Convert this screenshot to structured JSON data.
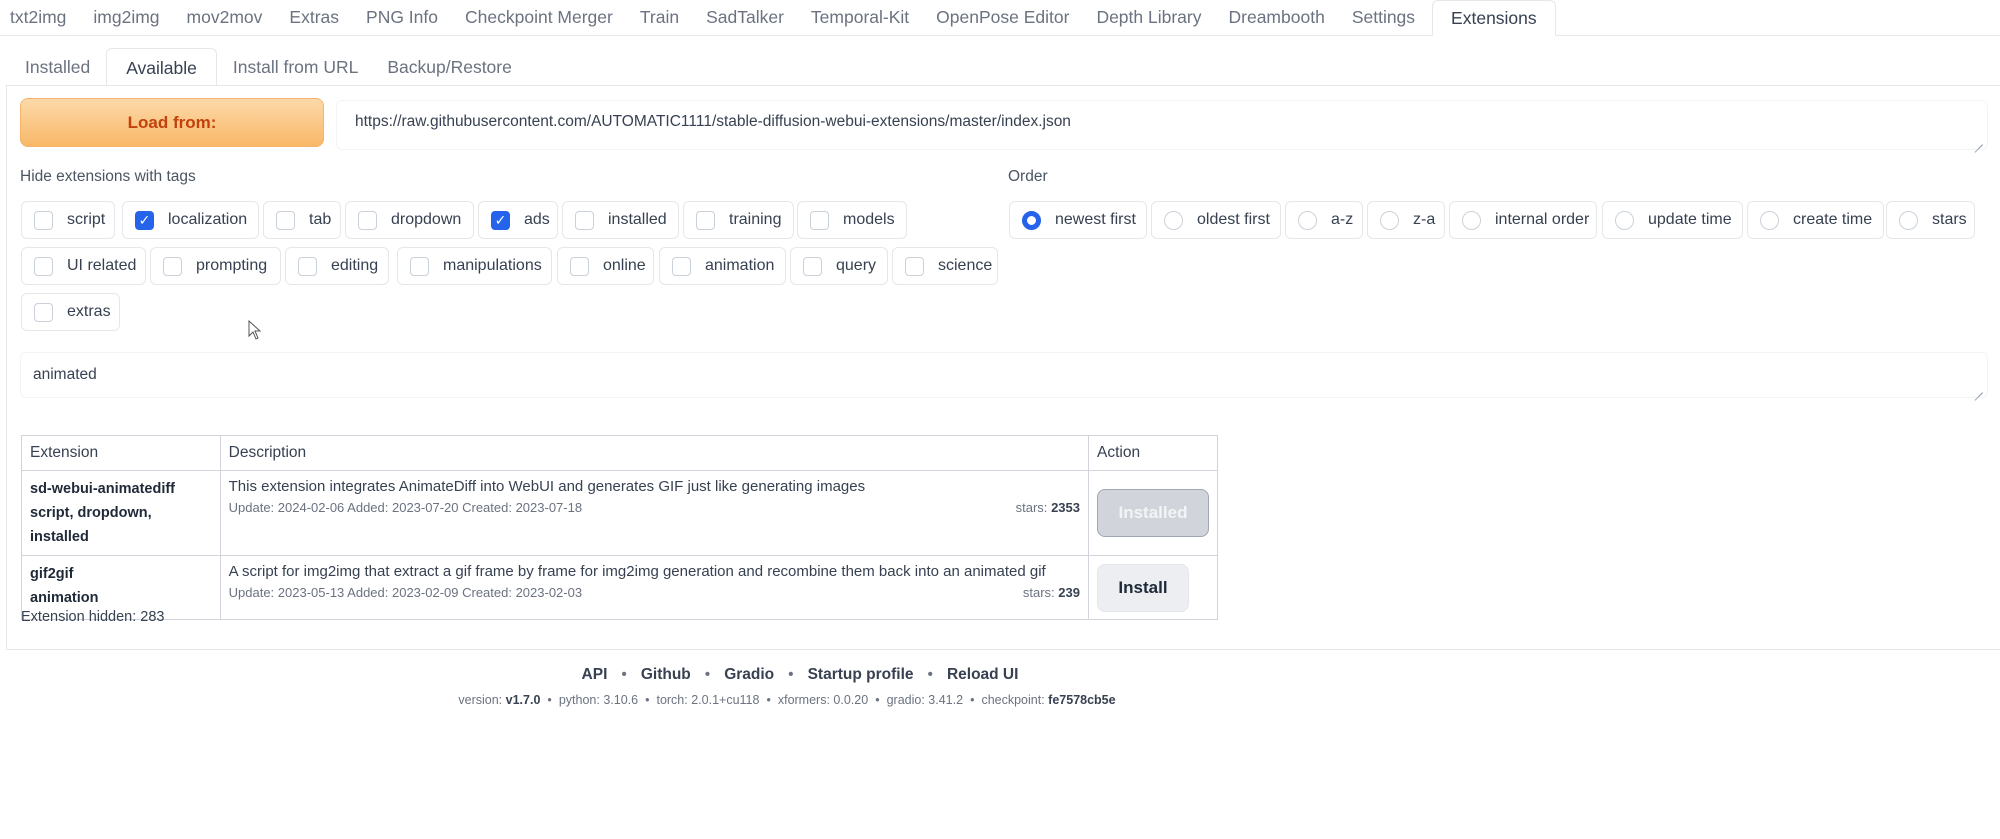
{
  "top_tabs": [
    "txt2img",
    "img2img",
    "mov2mov",
    "Extras",
    "PNG Info",
    "Checkpoint Merger",
    "Train",
    "SadTalker",
    "Temporal-Kit",
    "OpenPose Editor",
    "Depth Library",
    "Dreambooth",
    "Settings",
    "Extensions"
  ],
  "sub_tabs": [
    "Installed",
    "Available",
    "Install from URL",
    "Backup/Restore"
  ],
  "load_button": "Load from:",
  "url_value": "https://raw.githubusercontent.com/AUTOMATIC1111/stable-diffusion-webui-extensions/master/index.json",
  "hide_tags_label": "Hide extensions with tags",
  "tags": [
    {
      "label": "script",
      "checked": false
    },
    {
      "label": "localization",
      "checked": true
    },
    {
      "label": "tab",
      "checked": false
    },
    {
      "label": "dropdown",
      "checked": false
    },
    {
      "label": "ads",
      "checked": true
    },
    {
      "label": "installed",
      "checked": false
    },
    {
      "label": "training",
      "checked": false
    },
    {
      "label": "models",
      "checked": false
    },
    {
      "label": "UI related",
      "checked": false
    },
    {
      "label": "prompting",
      "checked": false
    },
    {
      "label": "editing",
      "checked": false
    },
    {
      "label": "manipulations",
      "checked": false
    },
    {
      "label": "online",
      "checked": false
    },
    {
      "label": "animation",
      "checked": false
    },
    {
      "label": "query",
      "checked": false
    },
    {
      "label": "science",
      "checked": false
    },
    {
      "label": "extras",
      "checked": false
    }
  ],
  "order_label": "Order",
  "order_options": [
    {
      "label": "newest first",
      "selected": true
    },
    {
      "label": "oldest first",
      "selected": false
    },
    {
      "label": "a-z",
      "selected": false
    },
    {
      "label": "z-a",
      "selected": false
    },
    {
      "label": "internal order",
      "selected": false
    },
    {
      "label": "update time",
      "selected": false
    },
    {
      "label": "create time",
      "selected": false
    },
    {
      "label": "stars",
      "selected": false
    }
  ],
  "search_value": "animated",
  "table": {
    "headers": [
      "Extension",
      "Description",
      "Action"
    ],
    "rows": [
      {
        "name": "sd-webui-animatediff",
        "tags": "script, dropdown, installed",
        "description": "This extension integrates AnimateDiff into WebUI and generates GIF just like generating images",
        "dates": "Update: 2024-02-06 Added: 2023-07-20 Created: 2023-07-18",
        "stars_label": "stars:",
        "stars": "2353",
        "action": "Installed"
      },
      {
        "name": "gif2gif",
        "tags": "animation",
        "description": "A script for img2img that extract a gif frame by frame for img2img generation and recombine them back into an animated gif",
        "dates": "Update: 2023-05-13 Added: 2023-02-09 Created: 2023-02-03",
        "stars_label": "stars:",
        "stars": "239",
        "action": "Install"
      }
    ]
  },
  "hidden_text": "Extension hidden: 283",
  "footer": {
    "links": [
      "API",
      "Github",
      "Gradio",
      "Startup profile",
      "Reload UI"
    ],
    "sep": "•",
    "versions": [
      {
        "k": "version:",
        "v": "v1.7.0",
        "bold": true
      },
      {
        "k": "python:",
        "v": "3.10.6",
        "bold": false
      },
      {
        "k": "torch:",
        "v": "2.0.1+cu118",
        "bold": false
      },
      {
        "k": "xformers:",
        "v": "0.0.20",
        "bold": false
      },
      {
        "k": "gradio:",
        "v": "3.41.2",
        "bold": false
      },
      {
        "k": "checkpoint:",
        "v": "fe7578cb5e",
        "bold": true
      }
    ]
  },
  "colors": {
    "accent": "#2563eb",
    "load_button": "#f9b868",
    "load_text": "#c2410c"
  }
}
